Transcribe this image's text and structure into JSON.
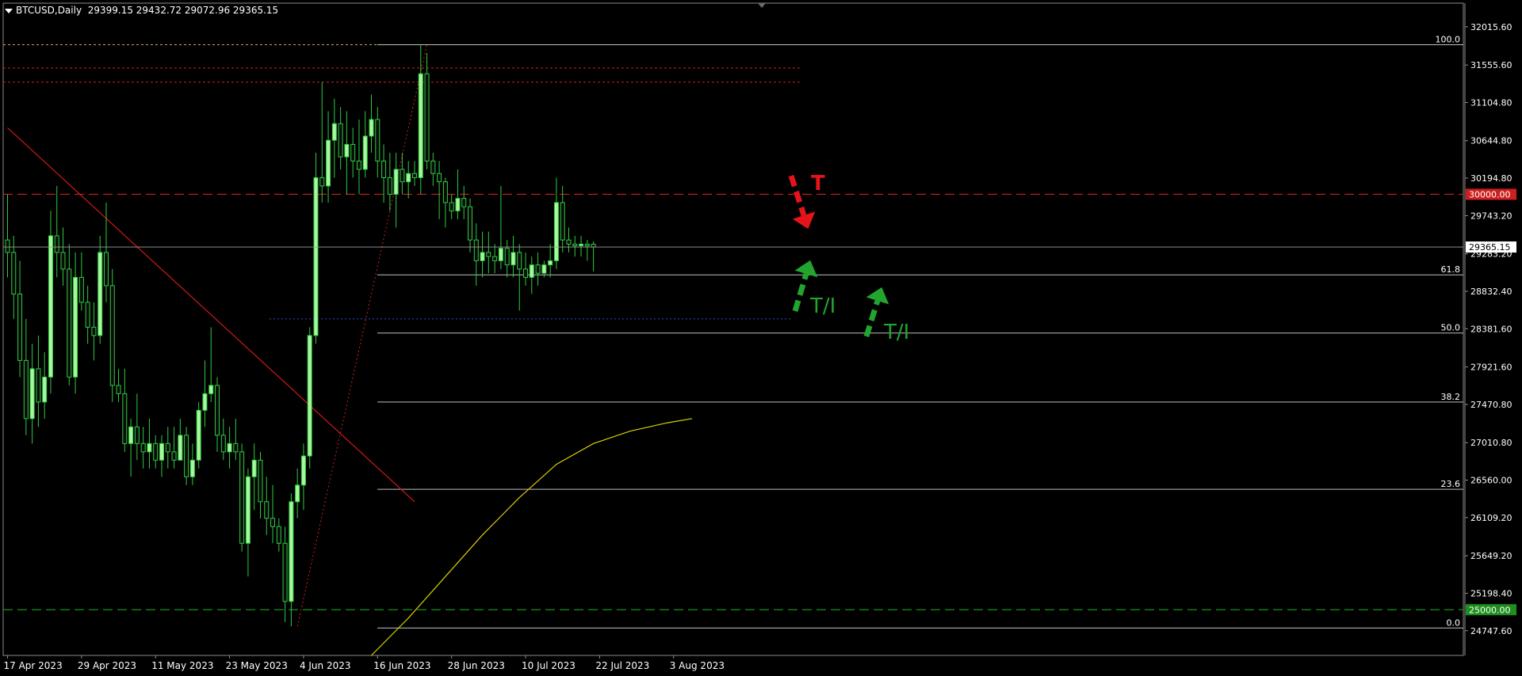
{
  "header": {
    "symbol_timeframe": "BTCUSD,Daily",
    "ohlc": "29399.15 29432.72 29072.96 29365.15"
  },
  "chart_data": {
    "type": "candlestick",
    "symbol": "BTCUSD",
    "timeframe": "Daily",
    "ylim": [
      24450,
      32300
    ],
    "price_axis_ticks": [
      "32015.60",
      "31555.60",
      "31104.80",
      "30644.80",
      "30194.80",
      "29743.20",
      "29283.20",
      "28832.40",
      "28381.60",
      "27921.60",
      "27470.80",
      "27010.80",
      "26560.00",
      "26109.20",
      "25649.20",
      "25198.40",
      "24747.60"
    ],
    "date_axis_ticks": [
      "17 Apr 2023",
      "29 Apr 2023",
      "11 May 2023",
      "23 May 2023",
      "4 Jun 2023",
      "16 Jun 2023",
      "28 Jun 2023",
      "10 Jul 2023",
      "22 Jul 2023",
      "3 Aug 2023"
    ],
    "date_tick_days": [
      0,
      12,
      24,
      36,
      48,
      60,
      72,
      84,
      96,
      108
    ],
    "ohlc": [
      [
        29450,
        30000,
        29000,
        29300
      ],
      [
        29300,
        29500,
        28500,
        28800
      ],
      [
        28800,
        29200,
        27800,
        28000
      ],
      [
        28000,
        28500,
        27100,
        27300
      ],
      [
        27300,
        28200,
        27000,
        27900
      ],
      [
        27900,
        28300,
        27200,
        27500
      ],
      [
        27500,
        28100,
        27300,
        27800
      ],
      [
        27800,
        29800,
        27600,
        29500
      ],
      [
        29500,
        30100,
        29000,
        29300
      ],
      [
        29300,
        29600,
        28900,
        29100
      ],
      [
        29100,
        29400,
        27700,
        27800
      ],
      [
        27800,
        29300,
        27600,
        29000
      ],
      [
        29000,
        29300,
        28600,
        28700
      ],
      [
        28700,
        28900,
        28200,
        28400
      ],
      [
        28400,
        28700,
        28000,
        28300
      ],
      [
        28300,
        29500,
        28200,
        29300
      ],
      [
        29300,
        29900,
        28700,
        28900
      ],
      [
        28900,
        29100,
        27500,
        27700
      ],
      [
        27700,
        27900,
        27500,
        27600
      ],
      [
        27600,
        27900,
        26900,
        27000
      ],
      [
        27000,
        27300,
        26600,
        27200
      ],
      [
        27200,
        27600,
        26800,
        27000
      ],
      [
        27000,
        27200,
        26700,
        26900
      ],
      [
        26900,
        27300,
        26700,
        27000
      ],
      [
        27000,
        27100,
        26700,
        26800
      ],
      [
        26800,
        27100,
        26600,
        27000
      ],
      [
        27000,
        27200,
        26700,
        26900
      ],
      [
        26900,
        27200,
        26700,
        26800
      ],
      [
        26800,
        27300,
        26800,
        27100
      ],
      [
        27100,
        27200,
        26500,
        26600
      ],
      [
        26600,
        27000,
        26500,
        26800
      ],
      [
        26800,
        27500,
        26700,
        27400
      ],
      [
        27400,
        28000,
        27200,
        27600
      ],
      [
        27600,
        28400,
        27500,
        27700
      ],
      [
        27700,
        27800,
        26900,
        27100
      ],
      [
        27100,
        27300,
        26800,
        26900
      ],
      [
        26900,
        27200,
        26700,
        27000
      ],
      [
        27000,
        27300,
        26800,
        26900
      ],
      [
        26900,
        27000,
        25700,
        25800
      ],
      [
        25800,
        26700,
        25400,
        26600
      ],
      [
        26600,
        27000,
        26200,
        26800
      ],
      [
        26800,
        26900,
        26100,
        26300
      ],
      [
        26300,
        26600,
        25900,
        26100
      ],
      [
        26100,
        26500,
        25800,
        26000
      ],
      [
        26000,
        26100,
        25700,
        25800
      ],
      [
        25800,
        26000,
        24850,
        25100
      ],
      [
        25100,
        26400,
        24800,
        26300
      ],
      [
        26300,
        26700,
        26100,
        26500
      ],
      [
        26500,
        27000,
        26200,
        26850
      ],
      [
        26850,
        28400,
        26700,
        28300
      ],
      [
        28300,
        30500,
        28200,
        30200
      ],
      [
        30200,
        31350,
        29900,
        30100
      ],
      [
        30100,
        31000,
        29900,
        30650
      ],
      [
        30650,
        31150,
        30200,
        30850
      ],
      [
        30850,
        31050,
        30300,
        30450
      ],
      [
        30450,
        31000,
        30000,
        30600
      ],
      [
        30600,
        30800,
        30200,
        30400
      ],
      [
        30400,
        30900,
        30000,
        30300
      ],
      [
        30300,
        31000,
        30200,
        30700
      ],
      [
        30700,
        31200,
        30500,
        30900
      ],
      [
        30900,
        31050,
        30200,
        30400
      ],
      [
        30400,
        30600,
        29900,
        30200
      ],
      [
        30200,
        30500,
        29800,
        30000
      ],
      [
        30000,
        30500,
        29600,
        30300
      ],
      [
        30300,
        30500,
        30000,
        30150
      ],
      [
        30150,
        30400,
        29950,
        30250
      ],
      [
        30250,
        30400,
        30100,
        30200
      ],
      [
        30200,
        31800,
        30000,
        31450
      ],
      [
        31450,
        31700,
        30300,
        30400
      ],
      [
        30400,
        30500,
        30100,
        30250
      ],
      [
        30250,
        30400,
        29700,
        30150
      ],
      [
        30150,
        30200,
        29600,
        29900
      ],
      [
        29900,
        30000,
        29700,
        29800
      ],
      [
        29800,
        30300,
        29700,
        29950
      ],
      [
        29950,
        30100,
        29700,
        29850
      ],
      [
        29850,
        29950,
        29300,
        29450
      ],
      [
        29450,
        29650,
        28900,
        29200
      ],
      [
        29200,
        29550,
        29000,
        29300
      ],
      [
        29300,
        29550,
        29050,
        29250
      ],
      [
        29250,
        29400,
        29050,
        29200
      ],
      [
        29200,
        30100,
        29100,
        29350
      ],
      [
        29350,
        29450,
        29000,
        29150
      ],
      [
        29150,
        29500,
        29000,
        29300
      ],
      [
        29300,
        29400,
        28600,
        29100
      ],
      [
        29100,
        29300,
        28900,
        29000
      ],
      [
        29000,
        29250,
        28800,
        29150
      ],
      [
        29150,
        29300,
        28900,
        29050
      ],
      [
        29050,
        29200,
        29000,
        29150
      ],
      [
        29150,
        29400,
        29000,
        29200
      ],
      [
        29200,
        30200,
        29100,
        29900
      ],
      [
        29900,
        30100,
        29300,
        29450
      ],
      [
        29450,
        29600,
        29300,
        29400
      ],
      [
        29400,
        29500,
        29250,
        29380
      ],
      [
        29380,
        29500,
        29250,
        29400
      ],
      [
        29400,
        29450,
        29200,
        29380
      ],
      [
        29399.15,
        29432.72,
        29072.96,
        29365.15
      ]
    ],
    "moving_average": [
      {
        "day": 59,
        "value": 24450
      },
      {
        "day": 65,
        "value": 24900
      },
      {
        "day": 71,
        "value": 25400
      },
      {
        "day": 77,
        "value": 25900
      },
      {
        "day": 83,
        "value": 26350
      },
      {
        "day": 89,
        "value": 26750
      },
      {
        "day": 95,
        "value": 27000
      },
      {
        "day": 101,
        "value": 27150
      },
      {
        "day": 107,
        "value": 27250
      },
      {
        "day": 111,
        "value": 27300
      }
    ],
    "fibonacci": {
      "levels": [
        {
          "label": "100.0",
          "price": 31800
        },
        {
          "label": "61.8",
          "price": 29030
        },
        {
          "label": "50.0",
          "price": 28330
        },
        {
          "label": "38.2",
          "price": 27500
        },
        {
          "label": "23.6",
          "price": 26450
        },
        {
          "label": "0.0",
          "price": 24780
        }
      ],
      "anchor_low": {
        "day": 47,
        "price": 24800
      },
      "anchor_high": {
        "day": 68,
        "price": 31800
      }
    },
    "trendline": {
      "start": {
        "day": 0,
        "price": 30800
      },
      "end": {
        "day": 66,
        "price": 26300
      }
    },
    "horizontal_levels": [
      {
        "price": 30000,
        "label": "30000.00",
        "color": "#cc1f1f",
        "style": "long-dash"
      },
      {
        "price": 25000,
        "label": "25000.00",
        "color": "#1e8f1e",
        "style": "long-dash"
      }
    ],
    "current_price": {
      "value": 29365.15,
      "label": "29365.15"
    },
    "resistance_zone_lines": [
      31800,
      31520,
      31350
    ],
    "annotations": [
      {
        "text": "T",
        "color": "#e4141a",
        "direction": "down"
      },
      {
        "text": "T/I",
        "color": "#22a52f",
        "direction": "up"
      },
      {
        "text": "T/I",
        "color": "#22a52f",
        "direction": "up"
      }
    ],
    "colors": {
      "bull": "#a9f5a0",
      "bear": "#0b0b0b",
      "wick": "#2ecc40",
      "grid": "#c0c0c0",
      "trendline": "#d11919",
      "ma": "#d8d000"
    }
  }
}
